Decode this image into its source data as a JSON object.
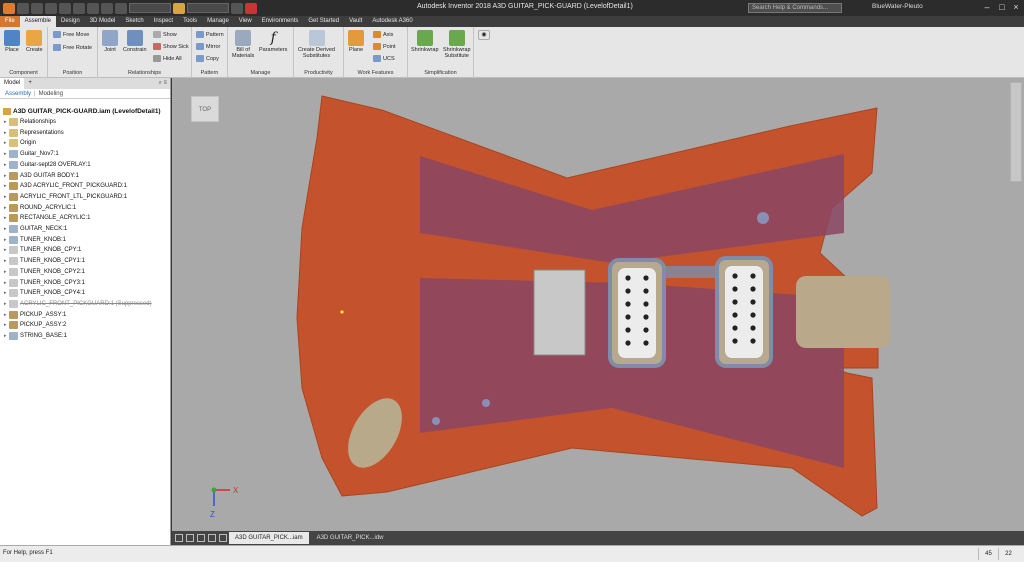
{
  "app": {
    "title": "Autodesk Inventor 2018   A3D GUITAR_PICK-GUARD (LevelofDetail1)",
    "help_search_placeholder": "Search Help & Commands...",
    "user": "BlueWater-Pleuto"
  },
  "ribbon_tabs": [
    "File",
    "Assemble",
    "Design",
    "3D Model",
    "Sketch",
    "Inspect",
    "Tools",
    "Manage",
    "View",
    "Environments",
    "Get Started",
    "Vault",
    "Autodesk A360"
  ],
  "active_tab": "Assemble",
  "ribbon": {
    "component": {
      "label": "Component",
      "place": "Place",
      "create": "Create"
    },
    "position": {
      "label": "Position",
      "free_move": "Free Move",
      "free_rotate": "Free Rotate"
    },
    "relationships": {
      "label": "Relationships",
      "joint": "Joint",
      "constrain": "Constrain",
      "show": "Show",
      "show_sick": "Show Sick",
      "hide_all": "Hide All"
    },
    "pattern": {
      "label": "Pattern",
      "pattern": "Pattern",
      "mirror": "Mirror",
      "copy": "Copy"
    },
    "manage": {
      "label": "Manage",
      "bom": "Bill of\nMaterials",
      "parameters": "Parameters"
    },
    "productivity": {
      "label": "Productivity",
      "create_derived": "Create Derived\nSubstitutes"
    },
    "work_features": {
      "label": "Work Features",
      "plane": "Plane",
      "axis": "Axis",
      "point": "Point",
      "ucs": "UCS"
    },
    "simplification": {
      "label": "Simplification",
      "shrinkwrap": "Shrinkwrap",
      "shrinkwrap_sub": "Shrinkwrap\nSubstitute"
    }
  },
  "browser": {
    "tabs": [
      "Model",
      "+"
    ],
    "subtabs": {
      "assembly": "Assembly",
      "modeling": "Modeling"
    },
    "root": "A3D GUITAR_PICK-GUARD.iam (LevelofDetail1)",
    "items": [
      {
        "label": "Relationships",
        "suppressed": false
      },
      {
        "label": "Representations",
        "suppressed": false
      },
      {
        "label": "Origin",
        "suppressed": false
      },
      {
        "label": "Guitar_Nov7:1",
        "suppressed": false
      },
      {
        "label": "Guitar-sept28 OVERLAY:1",
        "suppressed": false
      },
      {
        "label": "A3D GUITAR BODY:1",
        "suppressed": false
      },
      {
        "label": "A3D ACRYLIC_FRONT_PICKGUARD:1",
        "suppressed": false
      },
      {
        "label": "ACRYLIC_FRONT_LTL_PICKGUARD:1",
        "suppressed": false
      },
      {
        "label": "ROUND_ACRYLIC:1",
        "suppressed": false
      },
      {
        "label": "RECTANGLE_ACRYLIC:1",
        "suppressed": false
      },
      {
        "label": "GUITAR_NECK:1",
        "suppressed": false
      },
      {
        "label": "TUNER_KNOB:1",
        "suppressed": false
      },
      {
        "label": "TUNER_KNOB_CPY:1",
        "suppressed": false
      },
      {
        "label": "TUNER_KNOB_CPY1:1",
        "suppressed": false
      },
      {
        "label": "TUNER_KNOB_CPY2:1",
        "suppressed": false
      },
      {
        "label": "TUNER_KNOB_CPY3:1",
        "suppressed": false
      },
      {
        "label": "TUNER_KNOB_CPY4:1",
        "suppressed": false
      },
      {
        "label": "ACRYLIC_FRONT_PICKGUARD:1 (Suppressed)",
        "suppressed": true
      },
      {
        "label": "PICKUP_ASSY:1",
        "suppressed": false
      },
      {
        "label": "PICKUP_ASSY:2",
        "suppressed": false
      },
      {
        "label": "STRING_BASE:1",
        "suppressed": false
      }
    ]
  },
  "viewcube_label": "TOP",
  "axes": {
    "x": "X",
    "z": "Z"
  },
  "doc_tabs": [
    "A3D GUITAR_PICK...iam",
    "A3D GUITAR_PICK...idw"
  ],
  "status": {
    "text": "For Help, press F1",
    "count1": "45",
    "count2": "22"
  },
  "colors": {
    "body": "#c4532d",
    "pickguard": "#8a4763",
    "accent_file": "#d5772e"
  }
}
